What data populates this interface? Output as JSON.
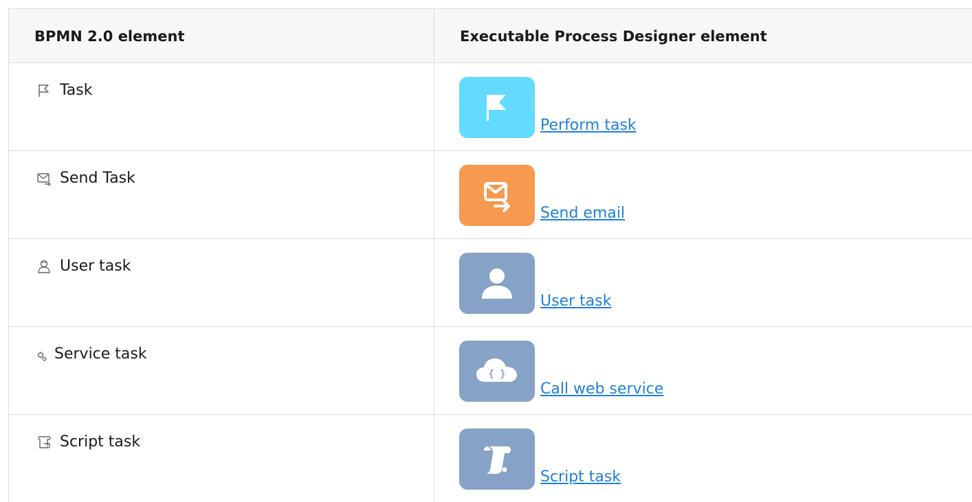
{
  "table": {
    "headers": [
      "BPMN 2.0 element",
      "Executable Process Designer element"
    ],
    "rows": [
      {
        "bpmn_label": "Task",
        "bpmn_icon": "flag-icon",
        "exec_label": "Perform task",
        "exec_icon": "flag-icon",
        "tile_color": "#63daff"
      },
      {
        "bpmn_label": "Send Task",
        "bpmn_icon": "envelope-arrow-icon",
        "exec_label": "Send email",
        "exec_icon": "send-email-icon",
        "tile_color": "#f7994f"
      },
      {
        "bpmn_label": "User task",
        "bpmn_icon": "user-icon",
        "exec_label": "User task",
        "exec_icon": "user-icon",
        "tile_color": "#87a2c7"
      },
      {
        "bpmn_label": "Service task",
        "bpmn_icon": "gears-icon",
        "exec_label": "Call web service",
        "exec_icon": "cloud-code-icon",
        "tile_color": "#87a2c7"
      },
      {
        "bpmn_label": "Script task",
        "bpmn_icon": "scroll-icon",
        "exec_label": "Script task",
        "exec_icon": "scroll-icon",
        "tile_color": "#87a2c7"
      }
    ]
  }
}
